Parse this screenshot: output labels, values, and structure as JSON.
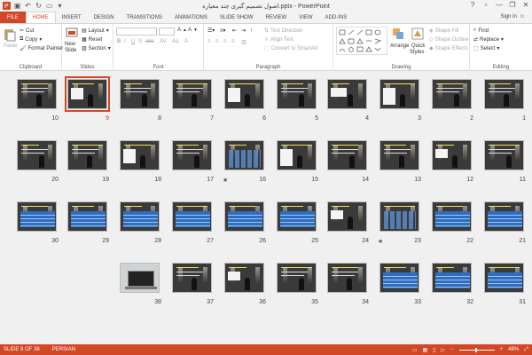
{
  "window": {
    "title": "اصول تصمیم گیری چند معیاره.pptx - PowerPoint",
    "help": "?",
    "minimize": "—",
    "restore": "❐",
    "close": "✕"
  },
  "tabs": [
    "FILE",
    "HOME",
    "INSERT",
    "DESIGN",
    "TRANSITIONS",
    "ANIMATIONS",
    "SLIDE SHOW",
    "REVIEW",
    "VIEW",
    "ADD-INS"
  ],
  "active_tab": "HOME",
  "sign_in": "Sign in",
  "ribbon": {
    "clipboard": {
      "label": "Clipboard",
      "paste": "Paste",
      "cut": "Cut",
      "copy": "Copy",
      "format_painter": "Format Painter"
    },
    "slides": {
      "label": "Slides",
      "new_slide": "New",
      "new_slide2": "Slide",
      "layout": "Layout",
      "reset": "Reset",
      "section": "Section"
    },
    "font": {
      "label": "Font"
    },
    "paragraph": {
      "label": "Paragraph",
      "text_direction": "Text Direction",
      "align_text": "Align Text",
      "convert_smartart": "Convert to SmartArt"
    },
    "drawing": {
      "label": "Drawing",
      "arrange": "Arrange",
      "quick_styles": "Quick",
      "quick_styles2": "Styles",
      "shape_fill": "Shape Fill",
      "shape_outline": "Shape Outline",
      "shape_effects": "Shape Effects"
    },
    "editing": {
      "label": "Editing",
      "find": "Find",
      "replace": "Replace",
      "select": "Select"
    }
  },
  "slides": [
    {
      "n": "10"
    },
    {
      "n": "9"
    },
    {
      "n": "8"
    },
    {
      "n": "7"
    },
    {
      "n": "6"
    },
    {
      "n": "5"
    },
    {
      "n": "4"
    },
    {
      "n": "3"
    },
    {
      "n": "2"
    },
    {
      "n": "1"
    },
    {
      "n": "20"
    },
    {
      "n": "19"
    },
    {
      "n": "18"
    },
    {
      "n": "17"
    },
    {
      "n": "16"
    },
    {
      "n": "15"
    },
    {
      "n": "14"
    },
    {
      "n": "13"
    },
    {
      "n": "12"
    },
    {
      "n": "11"
    },
    {
      "n": "30"
    },
    {
      "n": "29"
    },
    {
      "n": "28"
    },
    {
      "n": "27"
    },
    {
      "n": "26"
    },
    {
      "n": "25"
    },
    {
      "n": "24"
    },
    {
      "n": "23"
    },
    {
      "n": "22"
    },
    {
      "n": "21"
    },
    {
      "n": "38"
    },
    {
      "n": "37"
    },
    {
      "n": "36"
    },
    {
      "n": "35"
    },
    {
      "n": "34"
    },
    {
      "n": "33"
    },
    {
      "n": "32"
    },
    {
      "n": "31"
    }
  ],
  "selected_slide": "9",
  "animated_marker": "★",
  "status": {
    "slide_of": "SLIDE 9 OF 38",
    "language": "PERSIAN",
    "zoom": "48%"
  },
  "colors": {
    "accent": "#d24726",
    "slide_bg": "#3a3a3a",
    "table_blue": "#2e6dbf"
  }
}
